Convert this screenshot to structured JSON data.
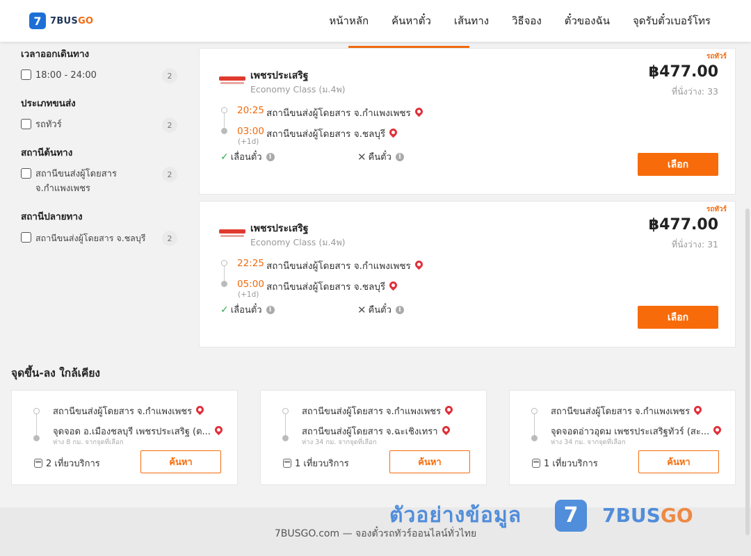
{
  "header": {
    "logo_mark": "7",
    "logo_text": "7BUS",
    "logo_text_go": "GO",
    "nav": [
      "หน้าหลัก",
      "ค้นหาตั๋ว",
      "เส้นทาง",
      "วิธีจอง",
      "ตั๋วของฉัน",
      "จุดรับตั๋วเบอร์โทร"
    ]
  },
  "filters": {
    "departure_time": {
      "title": "เวลาออกเดินทาง",
      "options": [
        {
          "label": "18:00 - 24:00",
          "count": "2"
        }
      ]
    },
    "transport_type": {
      "title": "ประเภทขนส่ง",
      "options": [
        {
          "label": "รถทัวร์",
          "count": "2"
        }
      ]
    },
    "origin_station": {
      "title": "สถานีต้นทาง",
      "options": [
        {
          "label": "สถานีขนส่งผู้โดยสาร จ.กำแพงเพชร",
          "count": "2"
        }
      ]
    },
    "destination_station": {
      "title": "สถานีปลายทาง",
      "options": [
        {
          "label": "สถานีขนส่งผู้โดยสาร จ.ชลบุรี",
          "count": "2"
        }
      ]
    }
  },
  "trips": [
    {
      "badge": "รถทัวร์",
      "operator": "เพชรประเสริฐ",
      "class": "Economy Class (ม.4พ)",
      "price": "฿477.00",
      "seats": "ที่นั่งว่าง: 33",
      "depart_time": "20:25",
      "depart_stop": "สถานีขนส่งผู้โดยสาร จ.กำแพงเพชร",
      "arrive_time": "03:00",
      "arrive_stop": "สถานีขนส่งผู้โดยสาร จ.ชลบุรี",
      "next_day": "(+1d)",
      "reschedule": "เลื่อนตั๋ว",
      "refund": "คืนตั๋ว",
      "button": "เลือก"
    },
    {
      "badge": "รถทัวร์",
      "operator": "เพชรประเสริฐ",
      "class": "Economy Class (ม.4พ)",
      "price": "฿477.00",
      "seats": "ที่นั่งว่าง: 31",
      "depart_time": "22:25",
      "depart_stop": "สถานีขนส่งผู้โดยสาร จ.กำแพงเพชร",
      "arrive_time": "05:00",
      "arrive_stop": "สถานีขนส่งผู้โดยสาร จ.ชลบุรี",
      "next_day": "(+1d)",
      "reschedule": "เลื่อนตั๋ว",
      "refund": "คืนตั๋ว",
      "button": "เลือก"
    }
  ],
  "nearby": {
    "title": "จุดขึ้น-ลง ใกล้เคียง",
    "cards": [
      {
        "from": "สถานีขนส่งผู้โดยสาร จ.กำแพงเพชร",
        "to": "จุดจอด อ.เมืองชลบุรี เพชรประเสริฐ (ต...",
        "distance": "ห่าง 8 กม. จากจุดที่เลือก",
        "trips": "2 เที่ยวบริการ",
        "button": "ค้นหา"
      },
      {
        "from": "สถานีขนส่งผู้โดยสาร จ.กำแพงเพชร",
        "to": "สถานีขนส่งผู้โดยสาร จ.ฉะเชิงเทรา",
        "distance": "ห่าง 34 กม. จากจุดที่เลือก",
        "trips": "1 เที่ยวบริการ",
        "button": "ค้นหา"
      },
      {
        "from": "สถานีขนส่งผู้โดยสาร จ.กำแพงเพชร",
        "to": "จุดจอดอ่าวอุดม เพชรประเสริฐทัวร์ (สะ...",
        "distance": "ห่าง 34 กม. จากจุดที่เลือก",
        "trips": "1 เที่ยวบริการ",
        "button": "ค้นหา"
      }
    ]
  },
  "footer": {
    "text": "7BUSGO.com — จองตั๋วรถทัวร์ออนไลน์ทั่วไทย"
  },
  "watermark": {
    "text": "ตัวอย่างข้อมูล",
    "mark": "7",
    "brand": "7BUS",
    "brand_go": "GO"
  },
  "colors": {
    "accent": "#f76b0a",
    "brand_blue": "#1d6fd6",
    "time": "#f06a0f",
    "check": "#2ea84a"
  },
  "icons": {
    "pin": "map-pin-icon",
    "check": "check-icon",
    "x": "x-icon",
    "info": "info-icon",
    "bus": "bus-icon"
  }
}
